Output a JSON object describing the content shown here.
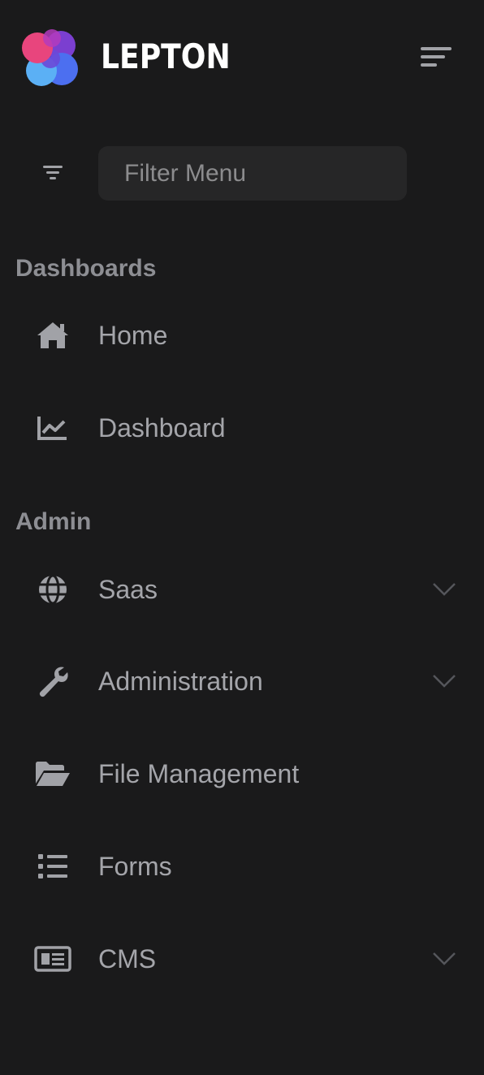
{
  "brand": {
    "name": "LEPTON",
    "logo_icon": "lepton-logo-icon",
    "menu_toggle_icon": "menu-toggle-icon"
  },
  "filter": {
    "icon": "filter-icon",
    "placeholder": "Filter Menu",
    "value": ""
  },
  "sections": [
    {
      "title": "Dashboards",
      "items": [
        {
          "label": "Home",
          "icon": "home-icon",
          "has_submenu": false
        },
        {
          "label": "Dashboard",
          "icon": "chart-line-icon",
          "has_submenu": false
        }
      ]
    },
    {
      "title": "Admin",
      "items": [
        {
          "label": "Saas",
          "icon": "globe-icon",
          "has_submenu": true
        },
        {
          "label": "Administration",
          "icon": "wrench-icon",
          "has_submenu": true
        },
        {
          "label": "File Management",
          "icon": "folder-open-icon",
          "has_submenu": false
        },
        {
          "label": "Forms",
          "icon": "list-icon",
          "has_submenu": false
        },
        {
          "label": "CMS",
          "icon": "newspaper-icon",
          "has_submenu": true
        }
      ]
    }
  ],
  "colors": {
    "background": "#1a1a1b",
    "filter_background": "#262627",
    "section_title": "#8d8e93",
    "item_text": "#a4a5aa",
    "icon": "#a1a2a7",
    "chevron": "#55565b",
    "brand_text": "#ffffff",
    "logo_pink": "#e8457d",
    "logo_purple": "#7b3fd0",
    "logo_blue": "#4c6ff0",
    "logo_light_blue": "#5bb0f5"
  }
}
